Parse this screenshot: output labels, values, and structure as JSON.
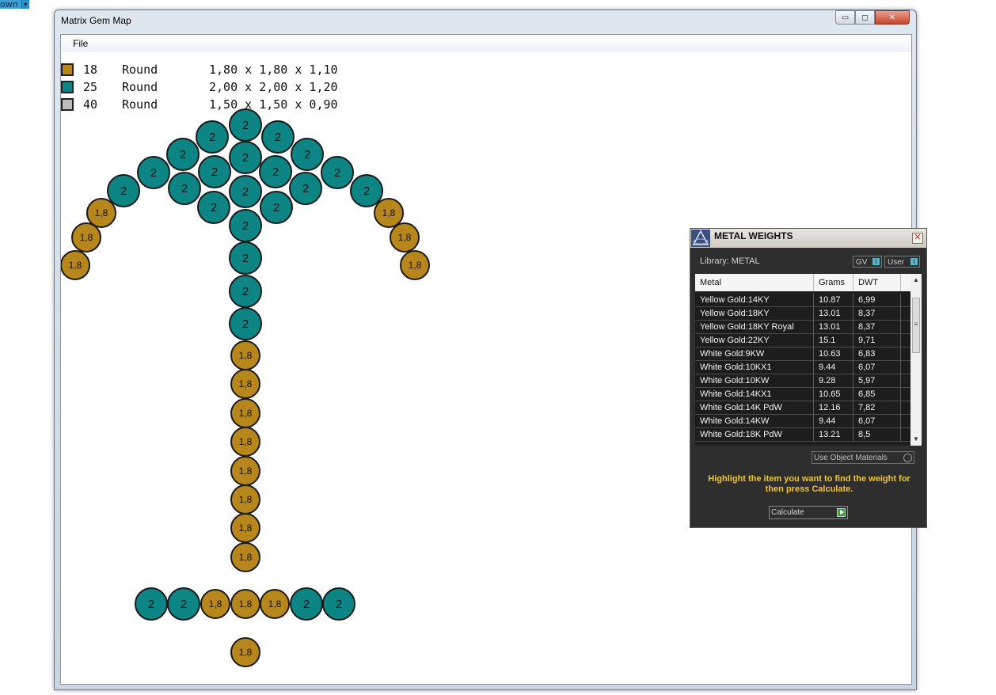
{
  "fragment": {
    "label": "own",
    "arrow": "▾"
  },
  "window": {
    "title": "Matrix Gem Map",
    "minimize": "▭",
    "maximize": "◻",
    "close": "✕"
  },
  "menu": {
    "file": "File"
  },
  "legend": [
    {
      "color": "#b8871c",
      "count": "18",
      "shape": "Round",
      "dims": "1,80 x 1,80 x 1,10"
    },
    {
      "color": "#0e8585",
      "count": "25",
      "shape": "Round",
      "dims": "2,00 x 2,00 x 1,20"
    },
    {
      "color": "#bcbcbc",
      "count": "40",
      "shape": "Round",
      "dims": "1,50 x 1,50 x 0,90"
    }
  ],
  "gem_labels": {
    "teal": "2",
    "gold": "1,8"
  },
  "metal_weights": {
    "title": "METAL WEIGHTS",
    "close": "✕",
    "library": "Library: METAL",
    "gv": "GV",
    "user": "User",
    "toggle_mark": "I",
    "columns": [
      "Metal",
      "Grams",
      "DWT"
    ],
    "rows": [
      [
        "Yellow Gold:14KY",
        "10.87",
        "6,99"
      ],
      [
        "Yellow Gold:18KY",
        "13.01",
        "8,37"
      ],
      [
        "Yellow Gold:18KY Royal",
        "13.01",
        "8,37"
      ],
      [
        "Yellow Gold:22KY",
        "15.1",
        "9,71"
      ],
      [
        "White Gold:9KW",
        "10.63",
        "6,83"
      ],
      [
        "White Gold:10KX1",
        "9.44",
        "6,07"
      ],
      [
        "White Gold:10KW",
        "9.28",
        "5,97"
      ],
      [
        "White Gold:14KX1",
        "10.65",
        "6,85"
      ],
      [
        "White Gold:14K PdW",
        "12.16",
        "7,82"
      ],
      [
        "White Gold:14KW",
        "9.44",
        "6,07"
      ],
      [
        "White Gold:18K PdW",
        "13.21",
        "8,5"
      ]
    ],
    "use_object_materials": "Use Object Materials",
    "hint": "Highlight the item you want to find the weight for then press Calculate.",
    "calculate": "Calculate"
  }
}
